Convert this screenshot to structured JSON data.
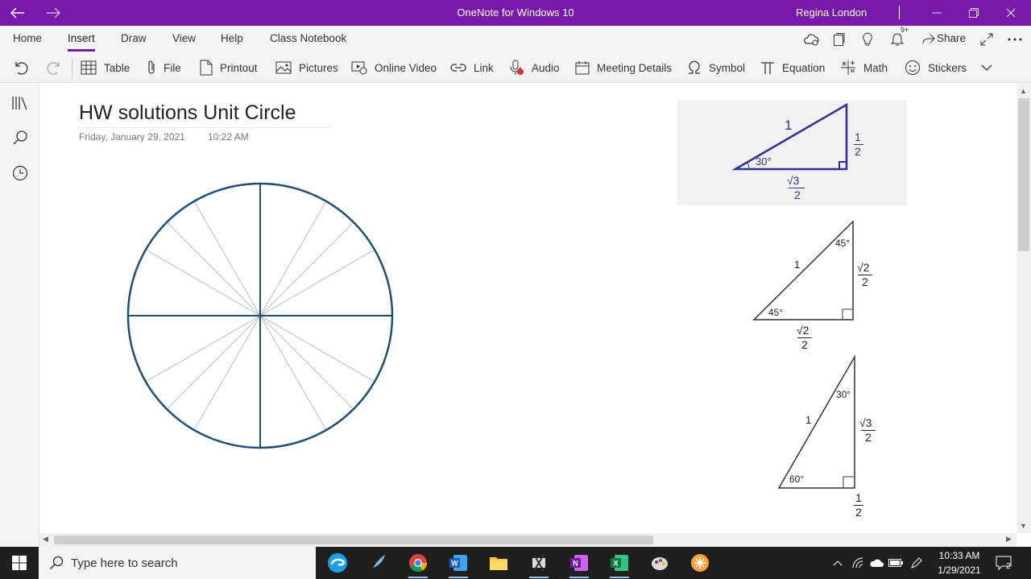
{
  "window": {
    "title": "OneNote for Windows 10",
    "user": "Regina London"
  },
  "menu": {
    "tabs": [
      "Home",
      "Insert",
      "Draw",
      "View",
      "Help",
      "Class Notebook"
    ],
    "active_tab": "Insert",
    "notification_badge": "9+",
    "share_label": "Share"
  },
  "ribbon": {
    "items": [
      "Table",
      "File",
      "Printout",
      "Pictures",
      "Online Video",
      "Link",
      "Audio",
      "Meeting Details",
      "Symbol",
      "Equation",
      "Math",
      "Stickers"
    ]
  },
  "page": {
    "title": "HW solutions Unit Circle",
    "date": "Friday, January 29, 2021",
    "time": "10:22 AM"
  },
  "triangles": {
    "t30_top": {
      "hyp": "1",
      "side_num": "1",
      "side_den": "2",
      "angle": "30°",
      "base_num": "√3",
      "base_den": "2"
    },
    "t45": {
      "hyp": "1",
      "top_angle": "45°",
      "bottom_angle": "45°",
      "side_num": "√2",
      "side_den": "2",
      "base_num": "√2",
      "base_den": "2"
    },
    "t30_60": {
      "hyp": "1",
      "top_angle": "30°",
      "bottom_angle": "60°",
      "side_num": "√3",
      "side_den": "2",
      "base_num": "1",
      "base_den": "2"
    }
  },
  "taskbar": {
    "search_placeholder": "Type here to search",
    "time": "10:33 AM",
    "date": "1/29/2021",
    "notification_count": "2"
  },
  "colors": {
    "titlebar": "#7719aa",
    "circle": "#1f4e79",
    "triangle_top": "#2e3192",
    "taskbar": "#1f1f1f"
  }
}
